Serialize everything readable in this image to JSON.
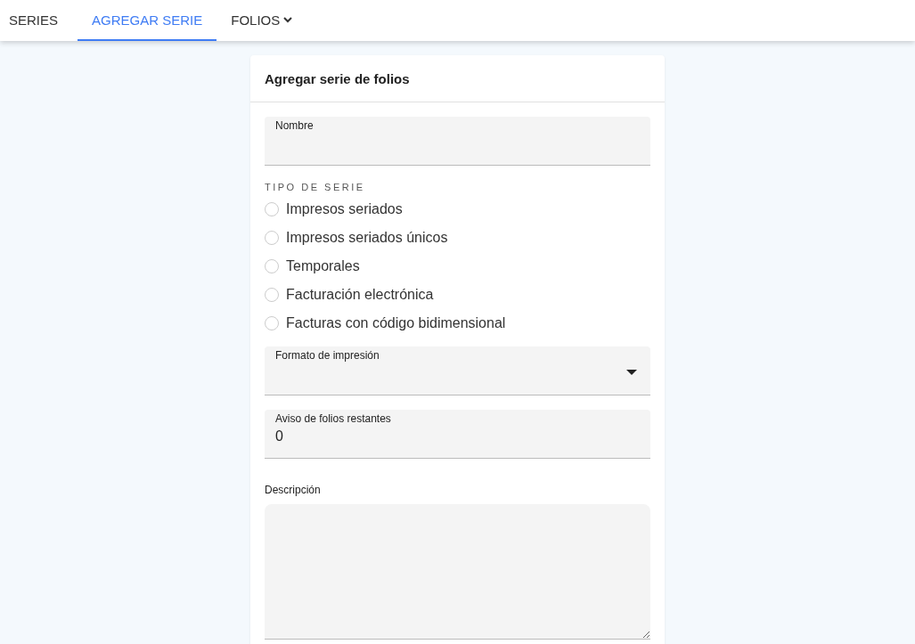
{
  "tabs": [
    {
      "label": "SERIES",
      "selected": false,
      "kind": "link"
    },
    {
      "label": "AGREGAR SERIE",
      "selected": true,
      "kind": "link"
    },
    {
      "label": "FOLIOS",
      "selected": false,
      "kind": "dropdown"
    }
  ],
  "card": {
    "title": "Agregar serie de folios",
    "name_field": {
      "label": "Nombre"
    },
    "series_type": {
      "label": "TIPO DE SERIE",
      "options": [
        {
          "label": "Impresos seriados",
          "checked": false
        },
        {
          "label": "Impresos seriados únicos",
          "checked": false
        },
        {
          "label": "Temporales",
          "checked": false
        },
        {
          "label": "Facturación electrónica",
          "checked": false
        },
        {
          "label": "Facturas con código bidimensional",
          "checked": false
        }
      ]
    },
    "print_format": {
      "label": "Formato de impresión"
    },
    "remaining_warning": {
      "label": "Aviso de folios restantes",
      "value": "0"
    },
    "description": {
      "label": "Descripción"
    }
  }
}
